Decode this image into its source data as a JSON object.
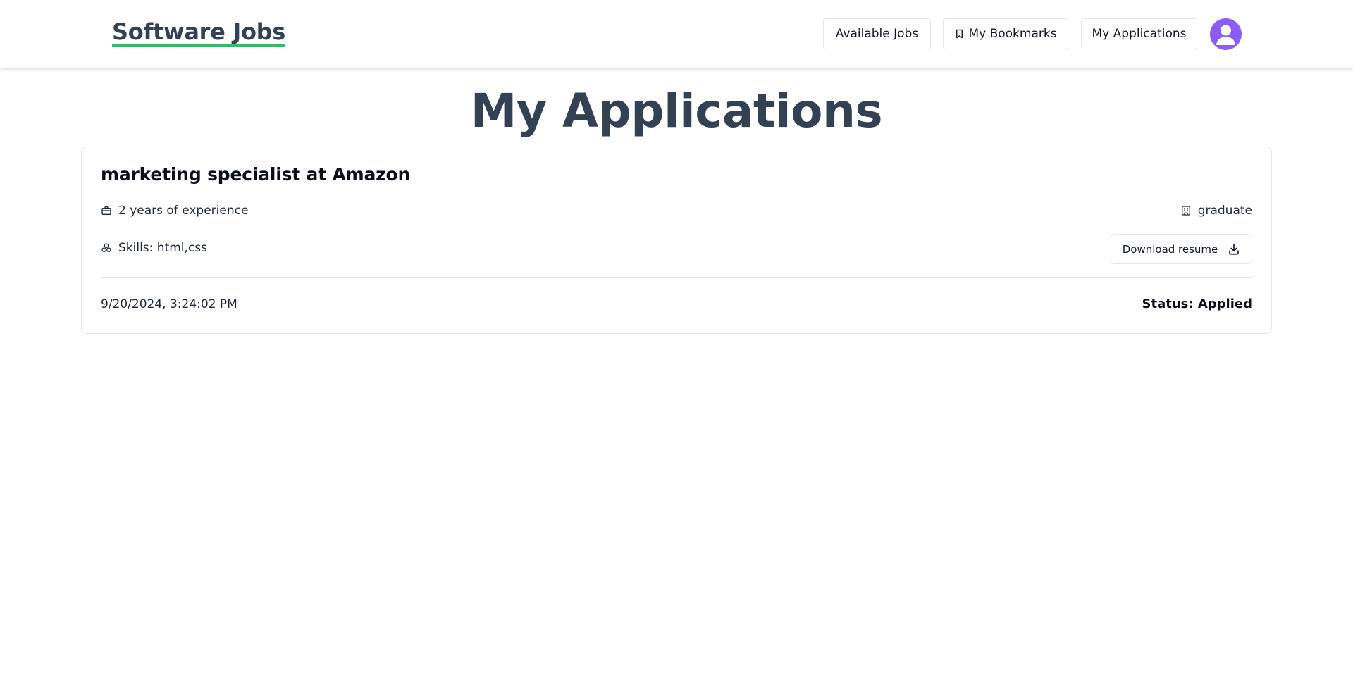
{
  "header": {
    "brand": "Software Jobs",
    "nav": {
      "available_jobs": "Available Jobs",
      "my_bookmarks": "My Bookmarks",
      "my_applications": "My Applications"
    },
    "avatar_icon": "user-avatar-icon"
  },
  "page": {
    "title": "My Applications"
  },
  "applications": [
    {
      "title": "marketing specialist at Amazon",
      "experience": "2 years of experience",
      "education": "graduate",
      "skills": "Skills: html,css",
      "download_label": "Download resume",
      "applied_at": "9/20/2024, 3:24:02 PM",
      "status": "Status: Applied"
    }
  ],
  "icons": {
    "bookmark": "bookmark-icon",
    "experience": "briefcase-icon",
    "education": "building-icon",
    "skills": "skills-cluster-icon",
    "download": "download-icon"
  },
  "colors": {
    "brand_text": "#334155",
    "brand_underline": "#22c55e",
    "avatar": "#8b5cf6",
    "title": "#334155"
  }
}
